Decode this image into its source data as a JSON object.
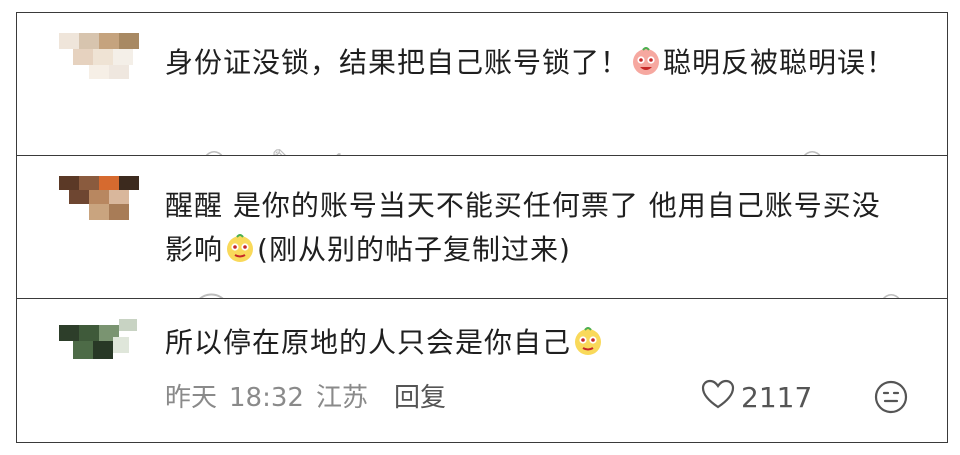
{
  "comments": [
    {
      "text_before": "身份证没锁，结果把自己账号锁了！",
      "emoji": "blush-face-emoji",
      "text_after": "聪明反被聪明误！"
    },
    {
      "text_before": "醒醒 是你的账号当天不能买任何票了 他用自己账号买没影响",
      "emoji": "smug-face-emoji",
      "text_after": "(刚从别的帖子复制过来)"
    },
    {
      "text_before": "所以停在原地的人只会是你自己",
      "emoji": "smug-face-emoji",
      "text_after": "",
      "date": "昨天",
      "time": "18:32",
      "location": "江苏",
      "reply_label": "回复",
      "like_count": "2117",
      "like_icon": "heart-icon",
      "reaction_icon": "neutral-face-icon"
    }
  ]
}
